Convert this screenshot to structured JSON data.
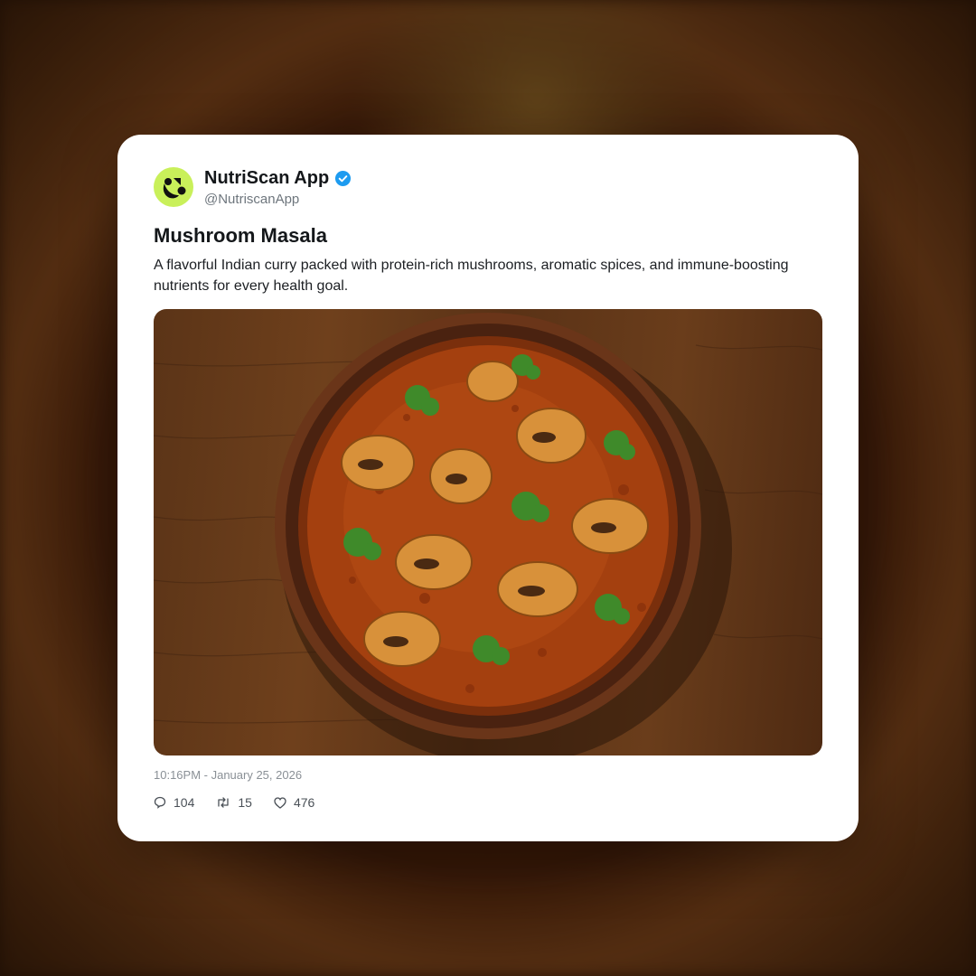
{
  "account": {
    "display_name": "NutriScan App",
    "handle": "@NutriscanApp",
    "verified": true,
    "avatar_color": "#c9f05a",
    "verified_color": "#1d9bf0"
  },
  "post": {
    "title": "Mushroom Masala",
    "description": "A flavorful Indian curry packed with protein-rich mushrooms, aromatic spices, and immune-boosting nutrients for every health goal.",
    "timestamp": "10:16PM - January 25, 2026"
  },
  "stats": {
    "replies": "104",
    "reposts": "15",
    "likes": "476"
  },
  "icons": {
    "reply": "speech-bubble-icon",
    "repost": "repost-arrows-icon",
    "like": "heart-icon",
    "verified": "verified-badge-icon"
  }
}
